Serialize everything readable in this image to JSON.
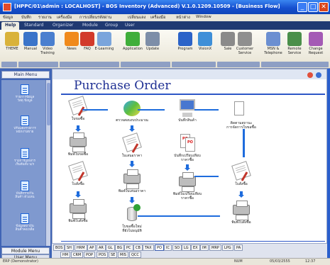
{
  "window": {
    "title": "[HPPC/01\\admin : LOCALHOST] - BOS Inventory (Advanced) V.1.0.1209.10509 - [Business Flow]",
    "controls": [
      "_",
      "□",
      "✕"
    ]
  },
  "menubar": [
    "ข้อมูล",
    "บันทึก",
    "รายงาน",
    "เครื่องมือ",
    "การเปลี่ยนรหัสผ่าน",
    "เปลี่ยนแลง",
    "เครื่องมือ",
    "หน้าต่าง",
    "Window"
  ],
  "tabs": [
    {
      "label": "Help",
      "active": true
    },
    {
      "label": "Standard",
      "active": false
    },
    {
      "label": "Organizer",
      "active": false
    },
    {
      "label": "Module",
      "active": false
    },
    {
      "label": "Group",
      "active": false
    },
    {
      "label": "User",
      "active": false
    }
  ],
  "ribbon": {
    "buttons": [
      {
        "label": "THEME",
        "icon": "theme-icon",
        "color": "#d9b23a"
      },
      {
        "label": "Manual",
        "icon": "manual-icon",
        "color": "#3a74c9"
      },
      {
        "label": "Video\nTraining",
        "icon": "video-icon",
        "color": "#4a7fcf"
      },
      {
        "label": "News",
        "icon": "news-icon",
        "color": "#f08a1c"
      },
      {
        "label": "FAQ",
        "icon": "faq-icon",
        "color": "#d23a2a"
      },
      {
        "label": "E-Learning",
        "icon": "elearning-icon",
        "color": "#7aa5dc"
      },
      {
        "label": "Application",
        "icon": "application-icon",
        "color": "#3fae3a"
      },
      {
        "label": "Update",
        "icon": "update-icon",
        "color": "#7d8ea8"
      },
      {
        "label": "Program",
        "icon": "program-icon",
        "color": "#2b63c8"
      },
      {
        "label": "VisionX",
        "icon": "visionx-icon",
        "color": "#3e8fd8"
      },
      {
        "label": "Sale",
        "icon": "sale-icon",
        "color": "#8a8a8a"
      },
      {
        "label": "Customer\nService",
        "icon": "customer-service-icon",
        "color": "#8f8f8f"
      },
      {
        "label": "MSN &\nTelephone",
        "icon": "msn-icon",
        "color": "#6b8fd1"
      },
      {
        "label": "Remote\nService",
        "icon": "remote-icon",
        "color": "#4a8f4a"
      },
      {
        "label": "Change\nRequest",
        "icon": "change-request-icon",
        "color": "#a45ab5"
      }
    ]
  },
  "sidebar": {
    "main_menu_label": "Main Menu",
    "items": [
      {
        "label": "รายการข้อมูล\nวัสดุ ข้อมูล"
      },
      {
        "label": "ปรับแต่งรายการ\nพนักงานขาย"
      },
      {
        "label": "รายการเอกสาร\nเริ่มต้นทั้ง บ/ก"
      },
      {
        "label": "บันทึกรายวัน\nสินค้า ตัวแทน"
      },
      {
        "label": "ข้อมูลสถาบัน\nสินค้าคงเหลือ"
      }
    ],
    "module_menu_label": "Module Menu",
    "user_menu_label": "User Menu"
  },
  "diagram": {
    "title": "Purchase Order",
    "nodes": [
      {
        "id": "requisition",
        "label": "ใบขอซื้อ",
        "icon": "paper-pen-icon"
      },
      {
        "id": "print-requisition",
        "label": "พิมพ์ใบขอซื้อ",
        "icon": "printer-icon"
      },
      {
        "id": "order",
        "label": "ใบสั่งซื้อ",
        "icon": "paper-pen-icon"
      },
      {
        "id": "print-order",
        "label": "พิมพ์ใบสั่งซื้อ",
        "icon": "printer-icon"
      },
      {
        "id": "check-budget",
        "label": "ตรวจสอบงบประมาณ",
        "icon": "cd-stack-icon"
      },
      {
        "id": "quotation",
        "label": "ใบเสนอราคา",
        "icon": "paper-pen-icon"
      },
      {
        "id": "print-quotation",
        "label": "พิมพ์ใบเสนอราคา",
        "icon": "printer-icon"
      },
      {
        "id": "supplier-db",
        "label": "ใบขอซื้อใหม่\nที่ยังไม่อนุมัติ",
        "icon": "database-icon"
      },
      {
        "id": "record-goods",
        "label": "บันทึกสินค้า",
        "icon": "monitor-icon"
      },
      {
        "id": "compare-price",
        "label": "บันทึกเปรียบเทียบ\nราคาซื้อ",
        "icon": "po-sheets-icon"
      },
      {
        "id": "print-compare",
        "label": "พิมพ์ใบเปรียบเทียบ\nราคาซื้อ",
        "icon": "printer-icon"
      },
      {
        "id": "goods-status",
        "label": "ติดตามสถานะ\nการจัดการใบขอซื้อ",
        "icon": "document-icon"
      },
      {
        "id": "purchase",
        "label": "ใบสั่งซื้อ",
        "icon": "paper-pen-icon"
      },
      {
        "id": "print-purchase",
        "label": "พิมพ์ใบสั่งซื้อ",
        "icon": "printer-icon"
      }
    ]
  },
  "module_tabs_row1": [
    "BOS",
    "SH",
    "HRM",
    "AP",
    "AR",
    "GL",
    "BG",
    "PC",
    "CB",
    "TAX",
    "PO",
    "IC",
    "SO",
    "LG",
    "EX",
    "IM",
    "MRP",
    "LPG",
    "PA"
  ],
  "module_tabs_row2": [
    "HM",
    "CRM",
    "POP",
    "POS",
    "SE",
    "MIS",
    "QCC"
  ],
  "active_module_tab": "PO",
  "statusbar": {
    "left": "ERP (Demonstrator)",
    "mid": "NUM",
    "date": "05/03/2555",
    "time": "12:37"
  }
}
